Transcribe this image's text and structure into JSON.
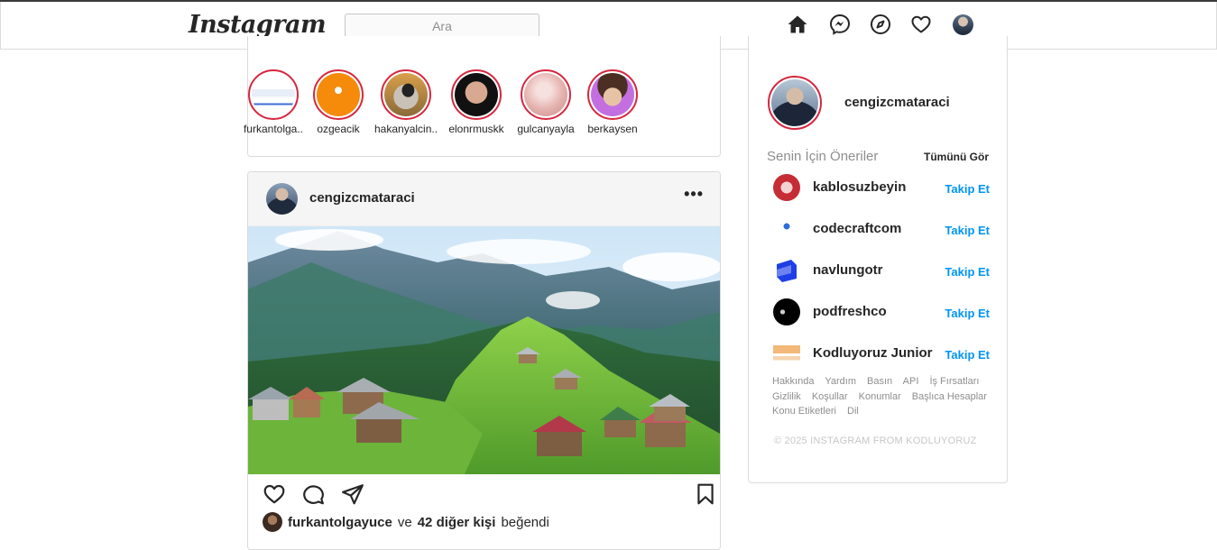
{
  "nav": {
    "logo": "Instagram",
    "search_placeholder": "Ara",
    "icons": [
      "home-icon",
      "messenger-icon",
      "explore-icon",
      "heart-icon",
      "profile-avatar"
    ]
  },
  "stories": [
    {
      "name": "furkantolga..",
      "style": "screenshot"
    },
    {
      "name": "ozgeacik",
      "style": "kodluyoruz"
    },
    {
      "name": "hakanyalcin..",
      "style": "sunglasses"
    },
    {
      "name": "elonrmuskk",
      "style": "dark-face"
    },
    {
      "name": "gulcanyayla",
      "style": "pink"
    },
    {
      "name": "berkaysen",
      "style": "purple"
    }
  ],
  "post": {
    "username": "cengizcmataraci",
    "more_label": "•••",
    "likes": {
      "user": "furkantolgayuce",
      "connector": "ve",
      "others": "42 diğer kişi",
      "suffix": "beğendi"
    }
  },
  "sidebar": {
    "username": "cengizcmataraci",
    "suggestions_title": "Senin İçin Öneriler",
    "see_all": "Tümünü Gör",
    "follow_label": "Takip Et",
    "suggestions": [
      {
        "name": "kablosuzbeyin",
        "logo": "brain-red"
      },
      {
        "name": "codecraftcom",
        "logo": "codecraft"
      },
      {
        "name": "navlungotr",
        "logo": "navlungo-blue"
      },
      {
        "name": "podfreshco",
        "logo": "podfresh-black"
      },
      {
        "name": "Kodluyoruz Junior",
        "logo": "kodluyoruz-junior"
      }
    ],
    "footer_links": [
      "Hakkında",
      "Yardım",
      "Basın",
      "API",
      "İş Fırsatları",
      "Gizlilik",
      "Koşullar",
      "Konumlar",
      "Başlıca Hesaplar",
      "Konu Etiketleri",
      "Dil"
    ],
    "copyright": "© 2025 INSTAGRAM FROM KODLUYORUZ"
  },
  "colors": {
    "story_ring": "#d6273f",
    "follow_blue": "#0095f6",
    "border": "#dbdbdb",
    "muted_text": "#8e8e8e"
  }
}
